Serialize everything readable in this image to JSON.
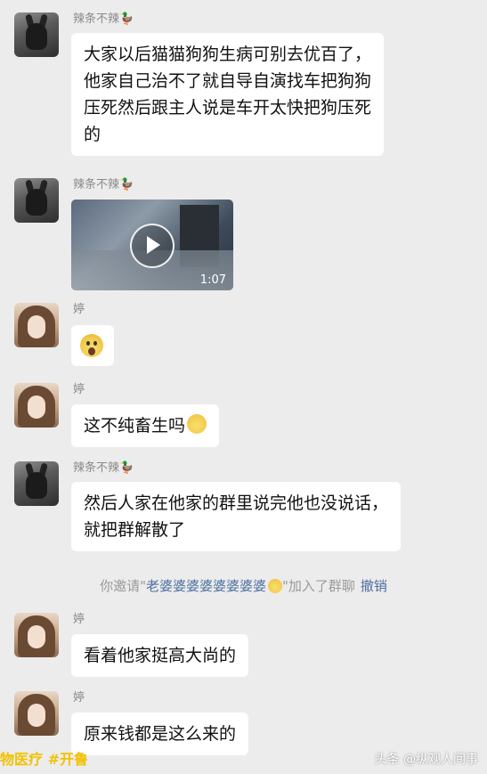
{
  "messages": [
    {
      "sender": "辣条不辣🦆",
      "lines": [
        "大家以后猫猫狗狗生病可别去优百了，",
        "他家自己治不了就自导自演找车把狗狗",
        "压死然后跟主人说是车开太快把狗压死",
        "的"
      ]
    },
    {
      "sender": "辣条不辣🦆",
      "video_duration": "1:07"
    },
    {
      "sender": "婷",
      "emoji": "scream-emoji"
    },
    {
      "sender": "婷",
      "text": "这不纯畜生吗",
      "emoji": "eye-roll-emoji"
    },
    {
      "sender": "辣条不辣🦆",
      "lines": [
        "然后人家在他家的群里说完他也没说话，",
        "就把群解散了"
      ]
    },
    {
      "sender": "婷",
      "text": "看着他家挺高大尚的"
    },
    {
      "sender": "婷",
      "text": "原来钱都是这么来的"
    }
  ],
  "system_notice": {
    "prefix": "你邀请\"",
    "invitee": "老婆婆婆婆婆婆婆婆",
    "suffix": "\"加入了群聊",
    "revoke": "撤销"
  },
  "watermark": {
    "left": "物医疗 #开鲁",
    "right": "头条 @纵观人间事"
  }
}
